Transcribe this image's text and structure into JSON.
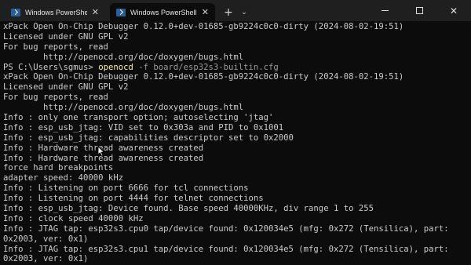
{
  "tabs": [
    {
      "title": "Windows PowerShell",
      "close_label": "✕",
      "active": false
    },
    {
      "title": "Windows PowerShell",
      "close_label": "✕",
      "active": true
    }
  ],
  "tab_actions": {
    "new_tab": "+",
    "dropdown": "⌄"
  },
  "window_controls": {
    "close": "✕"
  },
  "terminal": {
    "lines": [
      "xPack Open On-Chip Debugger 0.12.0+dev-01685-gb9224c0c0-dirty (2024-08-02-19:51)",
      "Licensed under GNU GPL v2",
      "For bug reports, read",
      "        http://openocd.org/doc/doxygen/bugs.html",
      {
        "prompt": "PS C:\\Users\\sgmus> ",
        "command": "openocd",
        "args": " -f board/esp32s3-builtin.cfg"
      },
      "xPack Open On-Chip Debugger 0.12.0+dev-01685-gb9224c0c0-dirty (2024-08-02-19:51)",
      "Licensed under GNU GPL v2",
      "For bug reports, read",
      "        http://openocd.org/doc/doxygen/bugs.html",
      "Info : only one transport option; autoselecting 'jtag'",
      "Info : esp_usb_jtag: VID set to 0x303a and PID to 0x1001",
      "Info : esp_usb_jtag: capabilities descriptor set to 0x2000",
      "Info : Hardware thread awareness created",
      "Info : Hardware thread awareness created",
      "force hard breakpoints",
      "adapter speed: 40000 kHz",
      "Info : Listening on port 6666 for tcl connections",
      "Info : Listening on port 4444 for telnet connections",
      "Info : esp_usb_jtag: Device found. Base speed 40000KHz, div range 1 to 255",
      "Info : clock speed 40000 kHz",
      "Info : JTAG tap: esp32s3.cpu0 tap/device found: 0x120034e5 (mfg: 0x272 (Tensilica), part:",
      "0x2003, ver: 0x1)",
      "Info : JTAG tap: esp32s3.cpu1 tap/device found: 0x120034e5 (mfg: 0x272 (Tensilica), part:",
      "0x2003, ver: 0x1)"
    ]
  },
  "colors": {
    "background": "#0c0c0c",
    "text": "#cccccc",
    "command": "#f9f1a5",
    "args": "#9a9a9a"
  }
}
